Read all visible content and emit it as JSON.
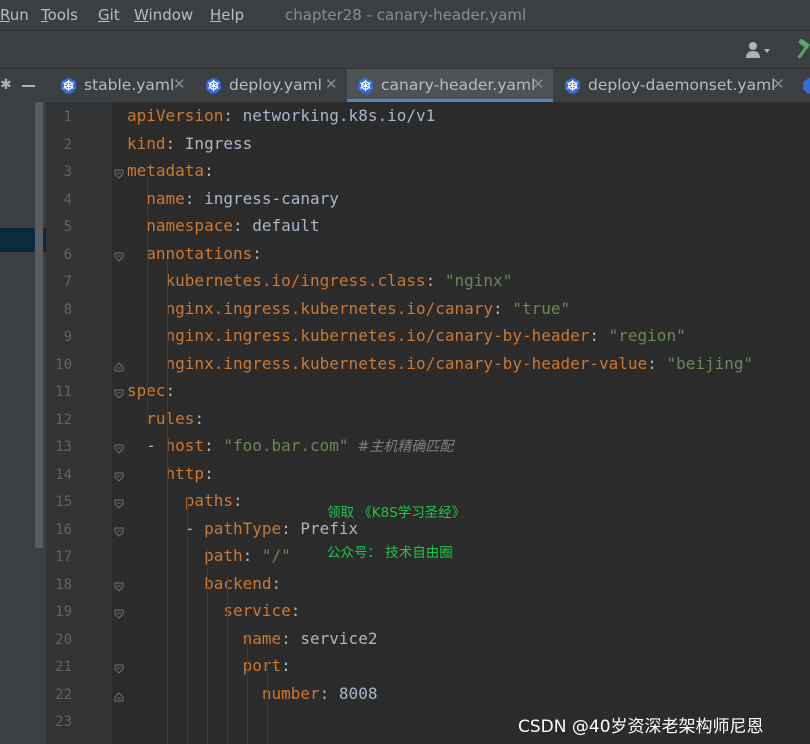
{
  "menu": {
    "items": [
      {
        "label": "Run",
        "u": "R",
        "rest": "un"
      },
      {
        "label": "Tools",
        "u": "T",
        "rest": "ools"
      },
      {
        "label": "Git",
        "u": "G",
        "rest": "it"
      },
      {
        "label": "Window",
        "u": "W",
        "rest": "indow"
      },
      {
        "label": "Help",
        "u": "H",
        "rest": "elp"
      }
    ],
    "window_title": "chapter28 - canary-header.yaml"
  },
  "toolbar": {
    "user_icon": "user-icon",
    "build_icon": "hammer-icon"
  },
  "tabs": [
    {
      "label": "stable.yaml",
      "active": false,
      "icon": "kubernetes-icon"
    },
    {
      "label": "deploy.yaml",
      "active": false,
      "icon": "kubernetes-icon"
    },
    {
      "label": "canary-header.yaml",
      "active": true,
      "icon": "kubernetes-icon"
    },
    {
      "label": "deploy-daemonset.yaml",
      "active": false,
      "icon": "kubernetes-icon"
    }
  ],
  "editor": {
    "lines": [
      {
        "n": "1",
        "indent": "",
        "key": "apiVersion",
        "sep": ": ",
        "val": "networking.k8s.io/v1"
      },
      {
        "n": "2",
        "indent": "",
        "key": "kind",
        "sep": ": ",
        "val": "Ingress"
      },
      {
        "n": "3",
        "indent": "",
        "key": "metadata",
        "sep": ":"
      },
      {
        "n": "4",
        "indent": "  ",
        "key": "name",
        "sep": ": ",
        "val": "ingress-canary"
      },
      {
        "n": "5",
        "indent": "  ",
        "key": "namespace",
        "sep": ": ",
        "val": "default"
      },
      {
        "n": "6",
        "indent": "  ",
        "key": "annotations",
        "sep": ":"
      },
      {
        "n": "7",
        "indent": "    ",
        "key": "kubernetes.io/ingress.class",
        "sep": ": ",
        "str": "\"nginx\""
      },
      {
        "n": "8",
        "indent": "    ",
        "key": "nginx.ingress.kubernetes.io/canary",
        "sep": ": ",
        "str": "\"true\""
      },
      {
        "n": "9",
        "indent": "    ",
        "key": "nginx.ingress.kubernetes.io/canary-by-header",
        "sep": ": ",
        "str": "\"region\""
      },
      {
        "n": "10",
        "indent": "    ",
        "key": "nginx.ingress.kubernetes.io/canary-by-header-value",
        "sep": ": ",
        "str": "\"beijing\""
      },
      {
        "n": "11",
        "indent": "",
        "key": "spec",
        "sep": ":"
      },
      {
        "n": "12",
        "indent": "  ",
        "key": "rules",
        "sep": ":"
      },
      {
        "n": "13",
        "indent": "  ",
        "dash": "- ",
        "key": "host",
        "sep": ": ",
        "str": "\"foo.bar.com\"",
        "comment": "  #主机精确匹配"
      },
      {
        "n": "14",
        "indent": "    ",
        "key": "http",
        "sep": ":"
      },
      {
        "n": "15",
        "indent": "      ",
        "key": "paths",
        "sep": ":"
      },
      {
        "n": "16",
        "indent": "      ",
        "dash": "- ",
        "key": "pathType",
        "sep": ": ",
        "val": "Prefix"
      },
      {
        "n": "17",
        "indent": "        ",
        "key": "path",
        "sep": ": ",
        "str": "\"/\""
      },
      {
        "n": "18",
        "indent": "        ",
        "key": "backend",
        "sep": ":"
      },
      {
        "n": "19",
        "indent": "          ",
        "key": "service",
        "sep": ":"
      },
      {
        "n": "20",
        "indent": "            ",
        "key": "name",
        "sep": ": ",
        "val": "service2"
      },
      {
        "n": "21",
        "indent": "            ",
        "key": "port",
        "sep": ":"
      },
      {
        "n": "22",
        "indent": "              ",
        "key": "number",
        "sep": ": ",
        "val": "8008"
      },
      {
        "n": "23",
        "indent": ""
      }
    ]
  },
  "overlay": {
    "line1": "领取 《K8S学习圣经》",
    "line2": "公众号： 技术自由圈"
  },
  "watermark": "CSDN @40岁资深老架构师尼恩",
  "colors": {
    "key": "#cc7832",
    "string": "#6a8759",
    "text": "#a9b7c6",
    "comment": "#808080",
    "active_tab_underline": "#4a88c7",
    "overlay_text": "#23c447"
  }
}
